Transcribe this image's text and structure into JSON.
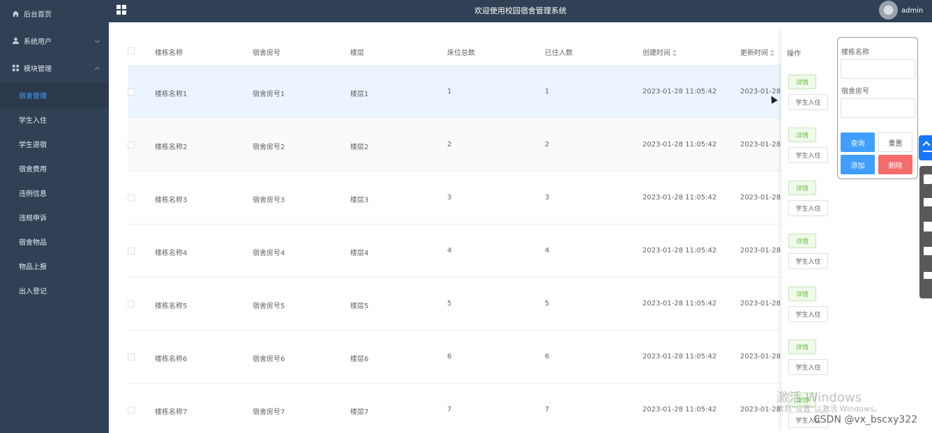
{
  "app": {
    "title": "欢迎使用校园宿舍管理系统",
    "user": "admin"
  },
  "sidebar": {
    "items": [
      {
        "label": "后台首页",
        "icon": "home-icon"
      },
      {
        "label": "系统用户",
        "icon": "user-icon",
        "expanded": false
      },
      {
        "label": "模块管理",
        "icon": "grid-icon",
        "expanded": true
      }
    ],
    "sub_items": [
      {
        "label": "宿舍管理",
        "active": true
      },
      {
        "label": "学生入住"
      },
      {
        "label": "学生退宿"
      },
      {
        "label": "宿舍费用"
      },
      {
        "label": "违例信息"
      },
      {
        "label": "违规申诉"
      },
      {
        "label": "宿舍物品"
      },
      {
        "label": "物品上报"
      },
      {
        "label": "出入登记"
      }
    ]
  },
  "table": {
    "columns": [
      "楼栋名称",
      "宿舍房号",
      "楼层",
      "床位总数",
      "已住人数",
      "创建时间",
      "更新时间",
      "操作"
    ],
    "rows": [
      {
        "building": "楼栋名称1",
        "room": "宿舍房号1",
        "floor": "楼层1",
        "beds": "1",
        "occupied": "1",
        "created": "2023-01-28 11:05:42",
        "updated": "2023-01-28"
      },
      {
        "building": "楼栋名称2",
        "room": "宿舍房号2",
        "floor": "楼层2",
        "beds": "2",
        "occupied": "2",
        "created": "2023-01-28 11:05:42",
        "updated": "2023-01-28"
      },
      {
        "building": "楼栋名称3",
        "room": "宿舍房号3",
        "floor": "楼层3",
        "beds": "3",
        "occupied": "3",
        "created": "2023-01-28 11:05:42",
        "updated": "2023-01-28"
      },
      {
        "building": "楼栋名称4",
        "room": "宿舍房号4",
        "floor": "楼层4",
        "beds": "4",
        "occupied": "4",
        "created": "2023-01-28 11:05:42",
        "updated": "2023-01-28"
      },
      {
        "building": "楼栋名称5",
        "room": "宿舍房号5",
        "floor": "楼层5",
        "beds": "5",
        "occupied": "5",
        "created": "2023-01-28 11:05:42",
        "updated": "2023-01-28"
      },
      {
        "building": "楼栋名称6",
        "room": "宿舍房号6",
        "floor": "楼层6",
        "beds": "6",
        "occupied": "6",
        "created": "2023-01-28 11:05:42",
        "updated": "2023-01-28"
      },
      {
        "building": "楼栋名称7",
        "room": "宿舍房号7",
        "floor": "楼层7",
        "beds": "7",
        "occupied": "7",
        "created": "2023-01-28 11:05:42",
        "updated": "2023-01-28"
      }
    ],
    "actions": {
      "detail": "详情",
      "checkin": "学生入住"
    }
  },
  "search": {
    "building_label": "楼栋名称",
    "room_label": "宿舍房号",
    "query": "查询",
    "reset": "重置",
    "add": "添加",
    "delete": "删除"
  },
  "watermark": {
    "line1": "激活 Windows",
    "line2": "转到\"设置\"以激活 Windows。",
    "credit": "CSDN @vx_bscxy322"
  },
  "colors": {
    "sidebar_bg": "#304156",
    "primary": "#409eff",
    "danger": "#f56c6c",
    "success": "#67c23a"
  }
}
